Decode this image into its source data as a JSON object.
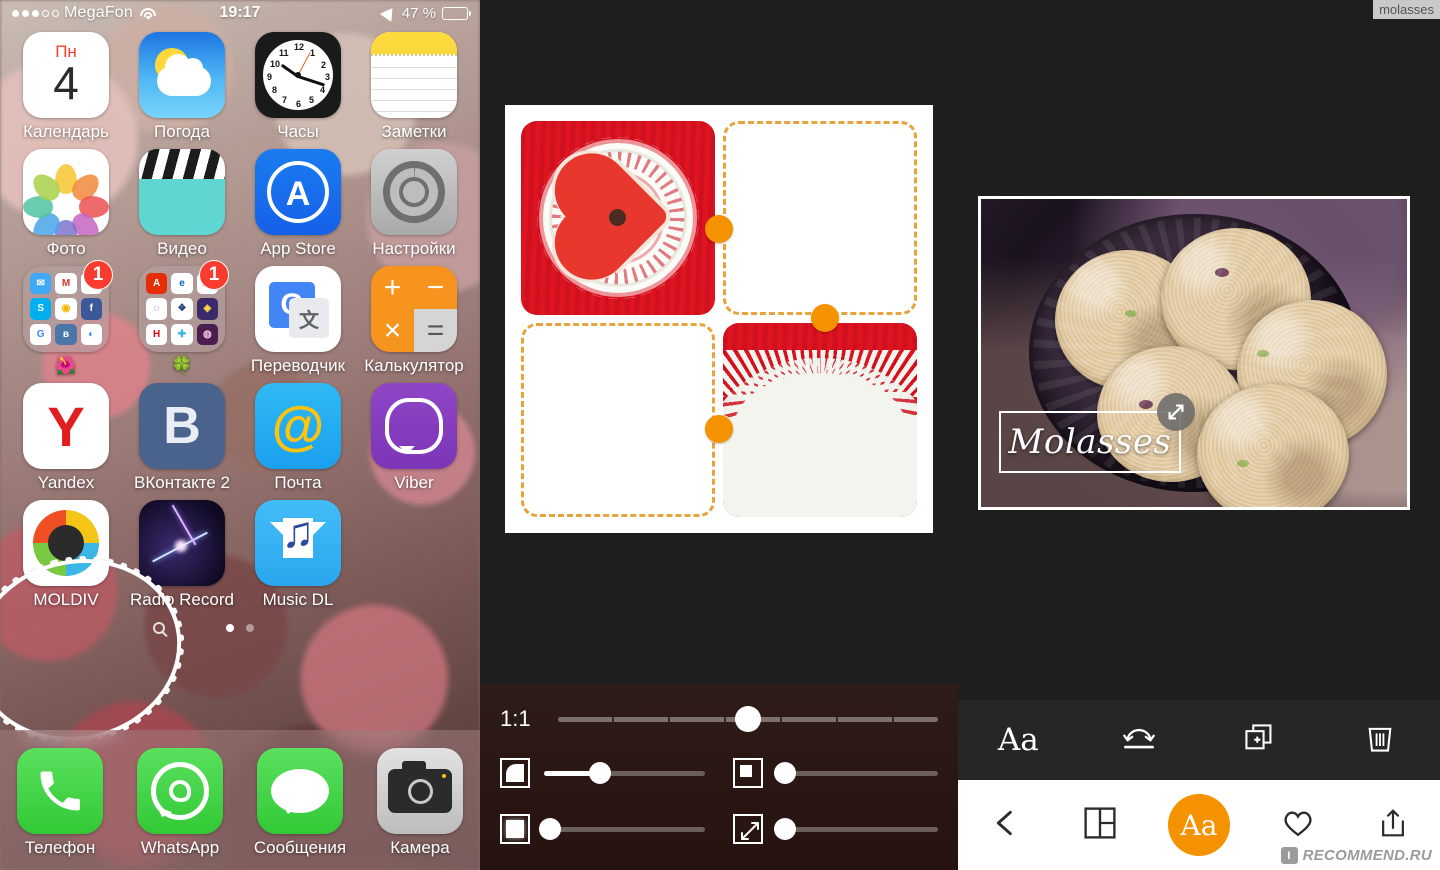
{
  "corner_tag": "molasses",
  "phone": {
    "status_bar": {
      "carrier": "MegaFon",
      "signal_dots_filled": 3,
      "signal_dots_total": 5,
      "wifi_icon": "wifi-icon",
      "time": "19:17",
      "location_icon": "location-arrow-icon",
      "battery_percent": "47 %",
      "battery_level": 47,
      "battery_color": "#fdd316"
    },
    "rows": [
      [
        {
          "label": "Календарь",
          "icon": "calendar-icon",
          "dow": "Пн",
          "day": "4"
        },
        {
          "label": "Погода",
          "icon": "weather-icon"
        },
        {
          "label": "Часы",
          "icon": "clock-icon",
          "numbers": [
            "12",
            "1",
            "2",
            "3",
            "4",
            "5",
            "6",
            "7",
            "8",
            "9",
            "10",
            "11"
          ]
        },
        {
          "label": "Заметки",
          "icon": "notes-icon"
        }
      ],
      [
        {
          "label": "Фото",
          "icon": "photos-icon"
        },
        {
          "label": "Видео",
          "icon": "videos-icon"
        },
        {
          "label": "App Store",
          "icon": "app-store-icon",
          "glyph": "A"
        },
        {
          "label": "Настройки",
          "icon": "settings-gear-icon"
        }
      ],
      [
        {
          "label": "🌺",
          "icon": "folder-icon",
          "badge": "1",
          "minis": [
            {
              "t": "✉",
              "bg": "#3fa9f5",
              "fg": "#fff"
            },
            {
              "t": "M",
              "bg": "#ffffff",
              "fg": "#d93025"
            },
            {
              "t": "✉",
              "bg": "#ffffff",
              "fg": "#e8452c"
            },
            {
              "t": "S",
              "bg": "#00aff0",
              "fg": "#fff"
            },
            {
              "t": "◉",
              "bg": "#ffffff",
              "fg": "#f4b400"
            },
            {
              "t": "f",
              "bg": "#3b5998",
              "fg": "#fff"
            },
            {
              "t": "G",
              "bg": "#ffffff",
              "fg": "#4285f4"
            },
            {
              "t": "в",
              "bg": "#4a76a8",
              "fg": "#fff"
            },
            {
              "t": "◐",
              "bg": "#ffffff",
              "fg": "#1b8ef2"
            }
          ]
        },
        {
          "label": "🍀",
          "icon": "folder-icon",
          "badge": "1",
          "minis": [
            {
              "t": "A",
              "bg": "#e62e04",
              "fg": "#fff"
            },
            {
              "t": "e",
              "bg": "#ffffff",
              "fg": "#0064d2"
            },
            {
              "t": "Ю",
              "bg": "#ffffff",
              "fg": "#e3001b"
            },
            {
              "t": "◌",
              "bg": "#ffffff",
              "fg": "#6c4ab6"
            },
            {
              "t": "❖",
              "bg": "#ffffff",
              "fg": "#24477e"
            },
            {
              "t": "◈",
              "bg": "#3b2a6b",
              "fg": "#ffd84d"
            },
            {
              "t": "H",
              "bg": "#ffffff",
              "fg": "#e50010"
            },
            {
              "t": "✚",
              "bg": "#ffffff",
              "fg": "#35b6e5"
            },
            {
              "t": "◍",
              "bg": "#4b1e52",
              "fg": "#ffc0e0"
            }
          ]
        },
        {
          "label": "Переводчик",
          "icon": "translate-icon",
          "glyph_a": "G",
          "glyph_b": "文"
        },
        {
          "label": "Калькулятор",
          "icon": "calculator-icon",
          "keys": [
            "+",
            "−",
            "×",
            "="
          ]
        }
      ],
      [
        {
          "label": "Yandex",
          "icon": "yandex-icon",
          "glyph": "Y"
        },
        {
          "label": "ВКонтакте 2",
          "icon": "vk-icon",
          "glyph": "B"
        },
        {
          "label": "Почта",
          "icon": "mail-icon",
          "glyph": "@"
        },
        {
          "label": "Viber",
          "icon": "viber-icon"
        }
      ],
      [
        {
          "label": "MOLDIV",
          "icon": "moldiv-icon",
          "highlighted": true
        },
        {
          "label": "Radio Record",
          "icon": "radio-record-icon"
        },
        {
          "label": "Music DL",
          "icon": "music-dl-icon"
        }
      ]
    ],
    "page_dots": {
      "count": 2,
      "active_index": 0,
      "search_icon": "search-icon"
    },
    "dock": [
      {
        "label": "Телефон",
        "icon": "phone-icon"
      },
      {
        "label": "WhatsApp",
        "icon": "whatsapp-icon"
      },
      {
        "label": "Сообщения",
        "icon": "messages-icon"
      },
      {
        "label": "Камера",
        "icon": "camera-icon"
      }
    ]
  },
  "collage": {
    "canvas": {
      "background": "#ffffff",
      "dash_color": "#e8a33d",
      "handle_color": "#f59200",
      "cells": [
        {
          "state": "filled",
          "content": "heart-cookie-on-red-doily"
        },
        {
          "state": "empty",
          "content": ""
        },
        {
          "state": "empty",
          "content": ""
        },
        {
          "state": "filled",
          "content": "white-paper-doily-on-red"
        }
      ],
      "handles": 3
    },
    "controls": {
      "ratio_label": "1:1",
      "sliders": [
        {
          "name": "aspect-ratio-slider",
          "icon": "",
          "value": 50,
          "notched": true
        },
        {
          "name": "outer-corner-radius-slider",
          "icon": "rounded-corner-icon",
          "value": 35
        },
        {
          "name": "inner-corner-radius-slider",
          "icon": "sharp-corner-icon",
          "value": 4
        },
        {
          "name": "border-thickness-slider",
          "icon": "filled-square-icon",
          "value": 3
        },
        {
          "name": "spacing-slider",
          "icon": "diagonal-arrow-icon",
          "value": 5
        }
      ]
    }
  },
  "photo_editor": {
    "photo": {
      "subject": "molasses cookies on dark glass plate",
      "frame_border_color": "#ffffff"
    },
    "text_overlay": {
      "text": "Molasses",
      "color": "#ffffff",
      "has_box": true
    },
    "resize_handle_icon": "diagonal-resize-icon",
    "toolbar": [
      {
        "label": "Aa",
        "icon": "font-icon",
        "name": "font-tool"
      },
      {
        "label": "",
        "icon": "flip-icon",
        "name": "flip-tool"
      },
      {
        "label": "",
        "icon": "duplicate-icon",
        "name": "duplicate-tool"
      },
      {
        "label": "",
        "icon": "trash-icon",
        "name": "delete-tool"
      }
    ],
    "bottom_bar": [
      {
        "label": "",
        "icon": "back-chevron-icon",
        "name": "back-button"
      },
      {
        "label": "",
        "icon": "collage-layout-icon",
        "name": "layout-button"
      },
      {
        "label": "Aa",
        "icon": "text-icon",
        "name": "text-button",
        "accent": "#f59200"
      },
      {
        "label": "",
        "icon": "heart-icon",
        "name": "favorite-button"
      },
      {
        "label": "",
        "icon": "share-icon",
        "name": "share-button"
      }
    ],
    "watermark": {
      "badge": "I",
      "text": "RECOMMEND.RU"
    }
  }
}
